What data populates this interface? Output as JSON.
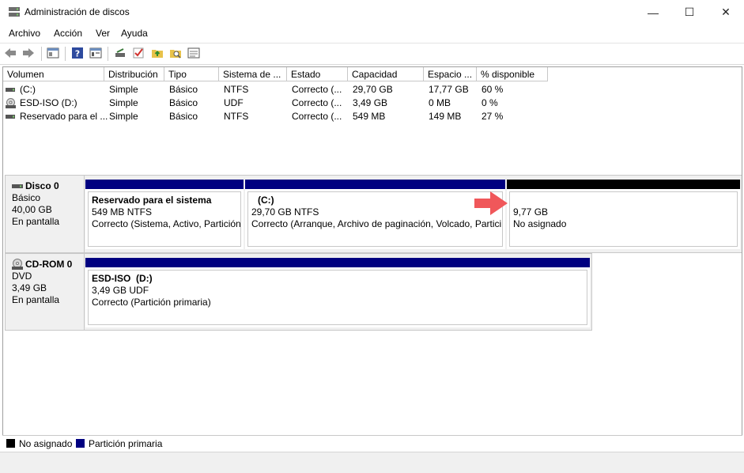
{
  "window": {
    "title": "Administración de discos",
    "minimize": "—",
    "maximize": "☐",
    "close": "✕"
  },
  "menu": [
    "Archivo",
    "Acción",
    "Ver",
    "Ayuda"
  ],
  "volume_table": {
    "headers": [
      "Volumen",
      "Distribución",
      "Tipo",
      "Sistema de ...",
      "Estado",
      "Capacidad",
      "Espacio ...",
      "% disponible"
    ],
    "rows": [
      {
        "volume": "(C:)",
        "layout": "Simple",
        "type": "Básico",
        "fs": "NTFS",
        "status": "Correcto (...",
        "capacity": "29,70 GB",
        "free": "17,77 GB",
        "pct": "60 %"
      },
      {
        "volume": "ESD-ISO (D:)",
        "layout": "Simple",
        "type": "Básico",
        "fs": "UDF",
        "status": "Correcto (...",
        "capacity": "3,49 GB",
        "free": "0 MB",
        "pct": "0 %"
      },
      {
        "volume": "Reservado para el ...",
        "layout": "Simple",
        "type": "Básico",
        "fs": "NTFS",
        "status": "Correcto (...",
        "capacity": "549 MB",
        "free": "149 MB",
        "pct": "27 %"
      }
    ]
  },
  "disks": [
    {
      "name": "Disco 0",
      "kind": "Básico",
      "size": "40,00 GB",
      "state": "En pantalla",
      "partitions": [
        {
          "name": "Reservado para el sistema",
          "size_fs": "549 MB NTFS",
          "status": "Correcto (Sistema, Activo, Partición"
        },
        {
          "name": "(C:)",
          "size_fs": "29,70 GB NTFS",
          "status": "Correcto (Arranque, Archivo de paginación, Volcado, Partici"
        },
        {
          "name": "",
          "size_fs": "9,77 GB",
          "status": "No asignado"
        }
      ]
    },
    {
      "name": "CD-ROM 0",
      "kind": "DVD",
      "size": "3,49 GB",
      "state": "En pantalla",
      "partitions": [
        {
          "name": "ESD-ISO  (D:)",
          "size_fs": "3,49 GB UDF",
          "status": "Correcto (Partición primaria)"
        }
      ]
    }
  ],
  "legend": {
    "unallocated": "No asignado",
    "primary": "Partición primaria"
  },
  "colors": {
    "primary_partition": "#000080",
    "unallocated": "#000000",
    "highlight_arrow": "#f0575a"
  },
  "icons": {
    "app": "disk-management-icon",
    "drive": "hard-drive-icon",
    "cdrom": "cd-drive-icon"
  }
}
